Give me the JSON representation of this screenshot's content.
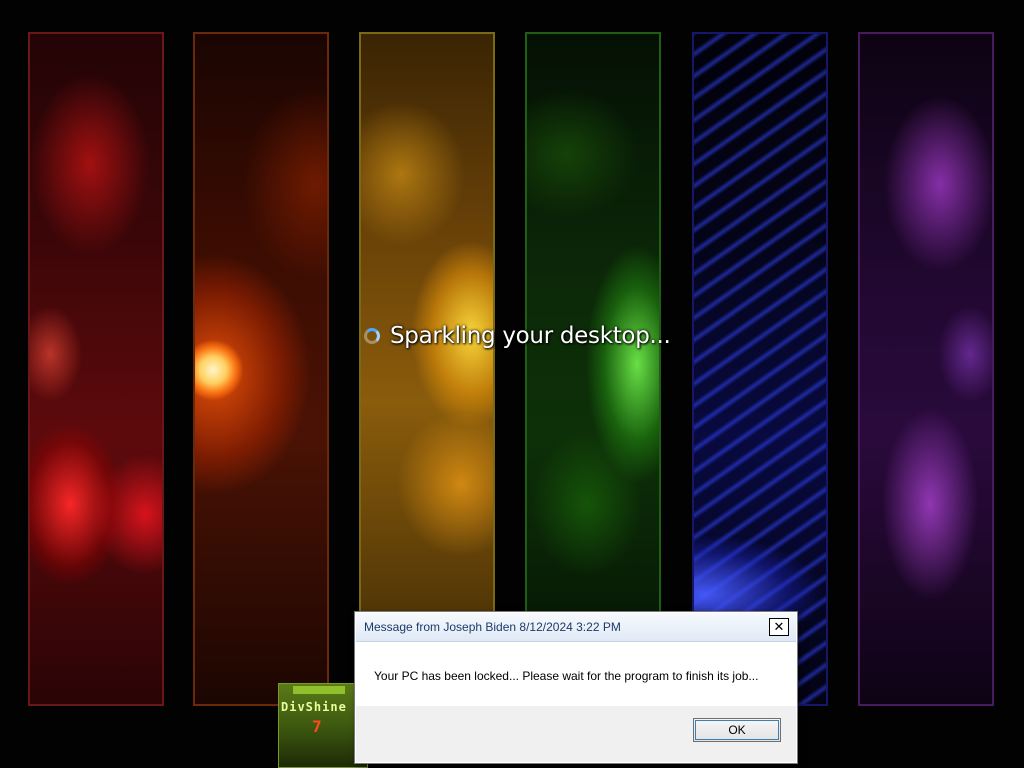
{
  "loading": {
    "text": "Sparkling your desktop..."
  },
  "logo": {
    "name": "DivShine",
    "version": "7"
  },
  "dialog": {
    "title": "Message from Joseph Biden 8/12/2024 3:22 PM",
    "close_glyph": "✕",
    "message": "Your PC has been locked... Please wait for the program to finish its job...",
    "ok_label": "OK"
  },
  "wallpaper": {
    "panel_colors": [
      "#b01010",
      "#e0600a",
      "#e6b81a",
      "#2fa81a",
      "#2a2ad8",
      "#8a2ab0"
    ]
  }
}
